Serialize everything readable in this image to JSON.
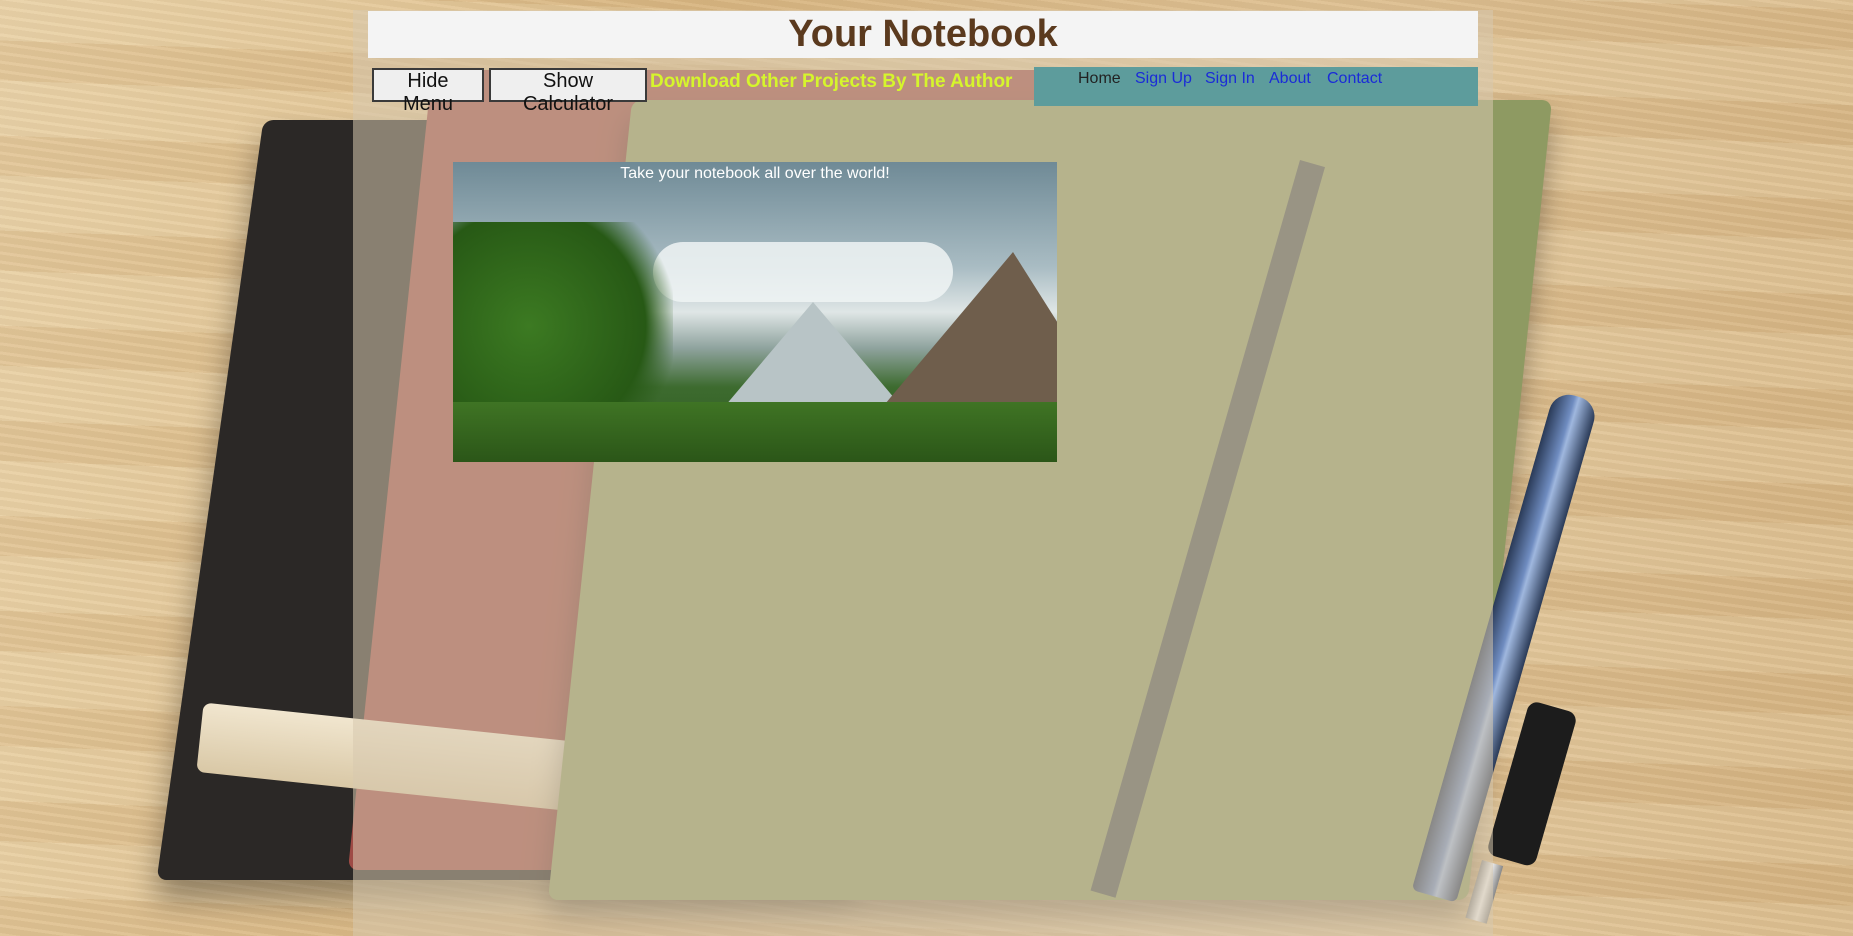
{
  "header": {
    "title": "Your Notebook"
  },
  "toolbar": {
    "hide_menu_label": "Hide Menu",
    "show_calculator_label": "Show Calculator",
    "download_link_label": "Download Other Projects By The Author"
  },
  "nav": {
    "items": [
      {
        "label": "Home"
      },
      {
        "label": "Sign Up"
      },
      {
        "label": "Sign In"
      },
      {
        "label": "About"
      },
      {
        "label": "Contact"
      }
    ]
  },
  "hero": {
    "caption": "Take your notebook all over the world!"
  },
  "colors": {
    "title": "#5b3a1e",
    "download_link": "#d6f52c",
    "nav_background": "#5d9c9c",
    "nav_link": "#1a2bd8",
    "nav_active": "#222222"
  }
}
